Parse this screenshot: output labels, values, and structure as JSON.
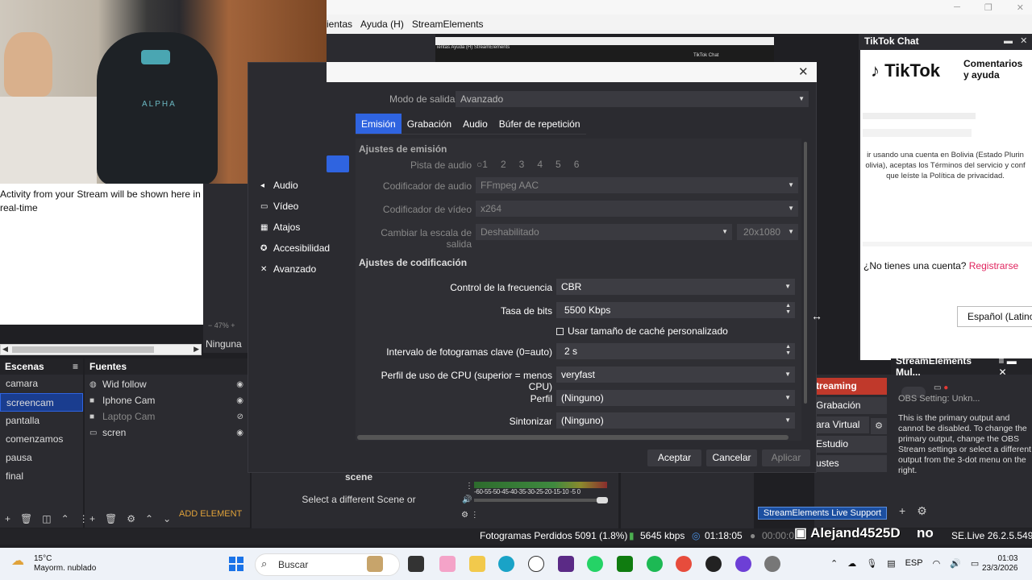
{
  "menubar": {
    "items": [
      "ientas",
      "Ayuda (H)",
      "StreamElements"
    ]
  },
  "activity": {
    "text": "Activity from your Stream will be shown here in real-time"
  },
  "preview": {
    "zoom": "47%",
    "ninguna": "Ninguna"
  },
  "scenes": {
    "title": "Escenas",
    "items": [
      "camara",
      "screencam",
      "pantalla",
      "comenzamos",
      "pausa",
      "final"
    ],
    "selected": "screencam"
  },
  "sources": {
    "title": "Fuentes",
    "items": [
      {
        "name": "Wid follow",
        "icon": "globe-icon",
        "visible": true
      },
      {
        "name": "Iphone Cam",
        "icon": "camera-icon",
        "visible": true
      },
      {
        "name": "Laptop Cam",
        "icon": "camera-icon",
        "visible": false
      },
      {
        "name": "scren",
        "icon": "monitor-icon",
        "visible": true
      }
    ],
    "add_element": "ADD ELEMENT"
  },
  "scene_panel": {
    "line1": "scene",
    "line2": "Select a different Scene or"
  },
  "mixer": {
    "labels": "-60-55-50-45-40-35-30-25-20-15-10 -5  0"
  },
  "controls": {
    "buttons": [
      "treaming",
      "Grabación",
      "ara Virtual",
      "Estudio",
      "ustes"
    ]
  },
  "se_multistream": {
    "title": "StreamElements Mul...",
    "output": "OBS Setting: Unkn...",
    "message": "This is the primary output and cannot be disabled. To change the primary output, change the OBS Stream settings or select a different output from the 3-dot menu on the right."
  },
  "tiktok": {
    "title": "TikTok Chat",
    "logo": "TikTok",
    "help": "Comentarios y ayuda",
    "terms": "ir usando una cuenta en Bolivia (Estado Plurin olivia), aceptas los Términos del servicio y conf que leíste la Política de privacidad.",
    "no_account": "¿No tienes una cuenta?",
    "register": "Registrarse",
    "language": "Español (Latino"
  },
  "nested": {
    "menu": "ientas  Ayuda (H)  StreamElements",
    "tt": "TikTok Chat"
  },
  "settings": {
    "nav": [
      {
        "label": "Audio",
        "icon": "speaker-icon"
      },
      {
        "label": "Vídeo",
        "icon": "monitor-icon"
      },
      {
        "label": "Atajos",
        "icon": "keyboard-icon"
      },
      {
        "label": "Accesibilidad",
        "icon": "accessibility-icon"
      },
      {
        "label": "Avanzado",
        "icon": "tools-icon"
      }
    ],
    "mode_label": "Modo de salida",
    "mode_value": "Avanzado",
    "tabs": [
      "Emisión",
      "Grabación",
      "Audio",
      "Búfer de repetición"
    ],
    "emission": {
      "title": "Ajustes de emisión",
      "audio_track_label": "Pista de audio",
      "tracks": [
        "1",
        "2",
        "3",
        "4",
        "5",
        "6"
      ],
      "audio_encoder_label": "Codificador de audio",
      "audio_encoder_value": "FFmpeg AAC",
      "video_encoder_label": "Codificador de vídeo",
      "video_encoder_value": "x264",
      "rescale_label": "Cambiar la escala de salida",
      "rescale_value": "Deshabilitado",
      "rescale_res": "20x1080"
    },
    "encoding": {
      "title": "Ajustes de codificación",
      "rate_label": "Control de la frecuencia",
      "rate_value": "CBR",
      "bitrate_label": "Tasa de bits",
      "bitrate_value": "5500 Kbps",
      "cache_label": "Usar tamaño de caché personalizado",
      "keyframe_label": "Intervalo de fotogramas clave (0=auto)",
      "keyframe_value": "2 s",
      "cpu_label": "Perfil de uso de CPU (superior = menos CPU)",
      "cpu_value": "veryfast",
      "profile_label": "Perfil",
      "profile_value": "(Ninguno)",
      "tune_label": "Sintonizar",
      "tune_value": "(Ninguno)"
    },
    "buttons": {
      "ok": "Aceptar",
      "cancel": "Cancelar",
      "apply": "Aplicar"
    }
  },
  "statusbar": {
    "dropped": "Fotogramas Perdidos 5091 (1.8%)",
    "kbps": "5645 kbps",
    "time": "01:18:05",
    "rec_time": "00:00:0",
    "version": "SE.Live 26.2.5.549",
    "support": "StreamElements Live Support",
    "overlay_name": "Alejand4525D",
    "overlay_suffix": "no"
  },
  "taskbar": {
    "temp": "15°C",
    "weather": "Mayorm. nublado",
    "search": "Buscar",
    "lang": "ESP",
    "time": "01:03",
    "date": "23/3/2026"
  },
  "colors": {
    "accent": "#2f64e0",
    "streaming": "#c0392b",
    "tiktok_red": "#e0245e"
  }
}
